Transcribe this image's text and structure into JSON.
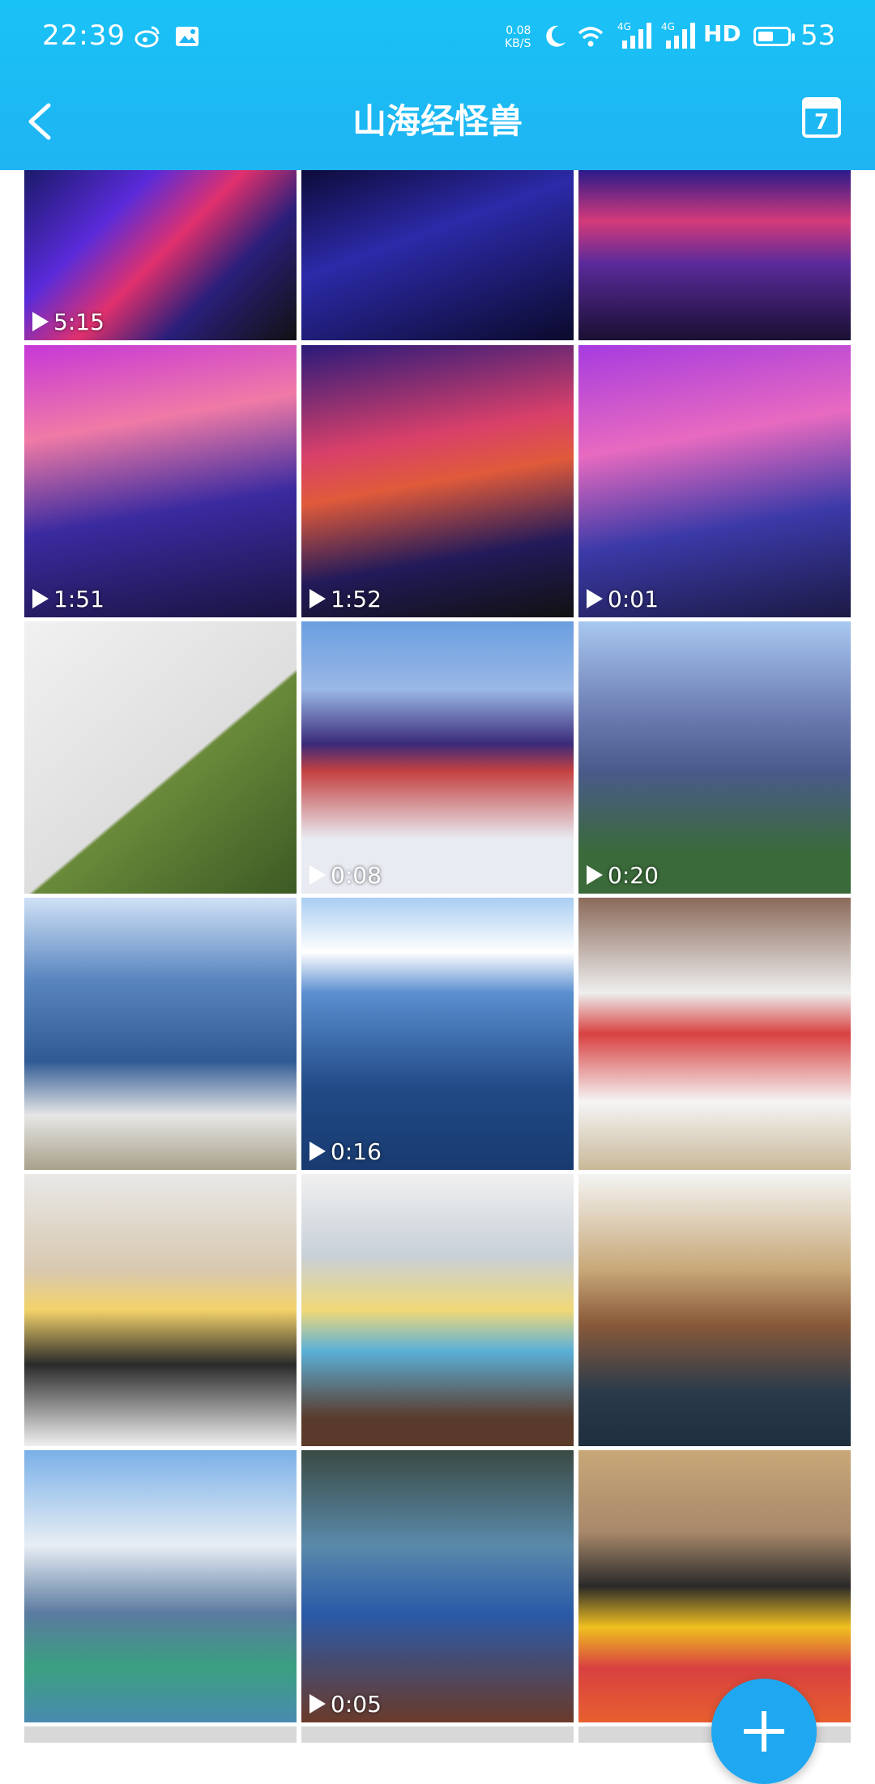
{
  "status": {
    "time": "22:39",
    "net_speed_value": "0.08",
    "net_speed_unit": "KB/S",
    "signal1": "4G",
    "signal2": "4G",
    "hd": "HD",
    "battery": "53",
    "battery_fraction": 0.53
  },
  "header": {
    "title": "山海经怪兽",
    "calendar_day": "7",
    "accent_color": "#1fb4f3"
  },
  "tiles": [
    {
      "duration": "5:15",
      "video": true
    },
    {
      "duration": "",
      "video": false
    },
    {
      "duration": "",
      "video": false
    },
    {
      "duration": "1:51",
      "video": true
    },
    {
      "duration": "1:52",
      "video": true
    },
    {
      "duration": "0:01",
      "video": true
    },
    {
      "duration": "",
      "video": false
    },
    {
      "duration": "0:08",
      "video": true
    },
    {
      "duration": "0:20",
      "video": true
    },
    {
      "duration": "",
      "video": false
    },
    {
      "duration": "0:16",
      "video": true
    },
    {
      "duration": "",
      "video": false
    },
    {
      "duration": "",
      "video": false
    },
    {
      "duration": "",
      "video": false
    },
    {
      "duration": "",
      "video": false
    },
    {
      "duration": "",
      "video": false
    },
    {
      "duration": "0:05",
      "video": true
    },
    {
      "duration": "",
      "video": false
    }
  ],
  "icons": {
    "back": "chevron-left-icon",
    "calendar": "calendar-icon",
    "fab": "plus-icon"
  }
}
